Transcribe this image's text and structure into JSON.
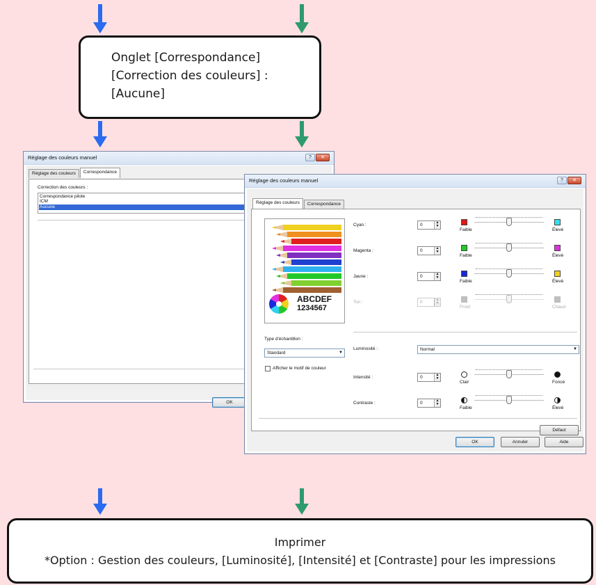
{
  "colors": {
    "background": "#ffe0e2",
    "arrow_left": "#2a6bf0",
    "arrow_right": "#2e9a6e"
  },
  "flow": {
    "step1": {
      "lines": [
        "Onglet [Correspondance]",
        "[Correction des couleurs] :",
        "[Aucune]"
      ]
    },
    "step2": {
      "title": "Imprimer",
      "note": "*Option : Gestion des couleurs, [Luminosité], [Intensité] et [Contraste] pour les impressions"
    }
  },
  "win_back": {
    "title": "Réglage des couleurs manuel",
    "tabs": [
      "Réglage des couleurs",
      "Correspondance"
    ],
    "correction_label": "Correction des couleurs :",
    "options": [
      "Correspondance pilote",
      "ICM",
      "Aucune"
    ],
    "ok": "OK"
  },
  "win_front": {
    "title": "Réglage des couleurs manuel",
    "tabs": [
      "Réglage des couleurs",
      "Correspondance"
    ],
    "preview": {
      "line1": "ABCDEF",
      "line2": "1234567"
    },
    "sample_type_label": "Type d'échantillon :",
    "sample_type_value": "Standard",
    "show_pattern_label": "Afficher le motif de couleur",
    "sliders": [
      {
        "label": "Cyan :",
        "value": "0",
        "low": "Faible",
        "high": "Élevé",
        "low_color": "#e01818",
        "high_color": "#33e0f0"
      },
      {
        "label": "Magenta :",
        "value": "0",
        "low": "Faible",
        "high": "Élevé",
        "low_color": "#22c82a",
        "high_color": "#e030e0"
      },
      {
        "label": "Jaune :",
        "value": "0",
        "low": "Faible",
        "high": "Élevé",
        "low_color": "#1a28d8",
        "high_color": "#f0d020"
      },
      {
        "label": "Ton :",
        "value": "0",
        "low": "Froid",
        "high": "Chaud",
        "low_color": "#c0c0c0",
        "high_color": "#c0c0c0"
      }
    ],
    "brightness_label": "Luminosité :",
    "brightness_value": "Normal",
    "intensity": {
      "label": "Intensité :",
      "value": "0",
      "low": "Clair",
      "high": "Foncé"
    },
    "contrast": {
      "label": "Contraste :",
      "value": "0",
      "low": "Faible",
      "high": "Élevé"
    },
    "default_button": "Défaut",
    "ok": "OK",
    "cancel": "Annuler",
    "help": "Aide"
  }
}
